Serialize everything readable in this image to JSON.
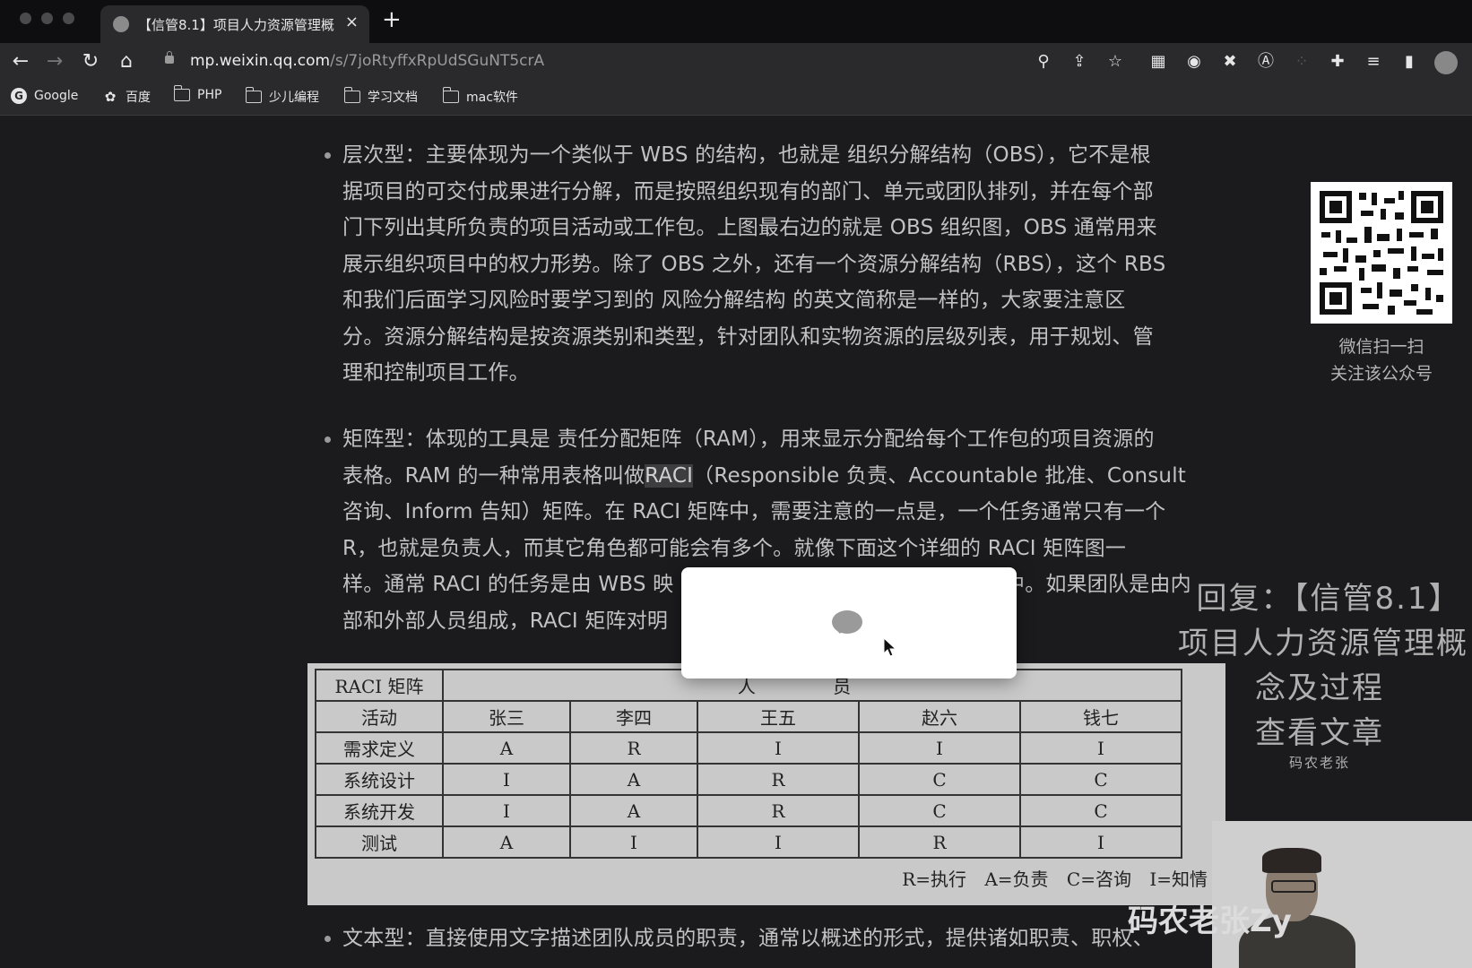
{
  "browser": {
    "tab_title": "【信管8.1】项目人力资源管理概",
    "new_tab": "+",
    "close": "×",
    "url_host": "mp.weixin.qq.com",
    "url_path": "/s/7joRtyffxRpUdSGuNT5crA",
    "bookmarks": [
      "Google",
      "百度",
      "PHP",
      "少儿编程",
      "学习文档",
      "mac软件"
    ]
  },
  "article": {
    "para1_lines": [
      "层次型：主要体现为一个类似于 WBS 的结构，也就是 组织分解结构（OBS），它不是根",
      "据项目的可交付成果进行分解，而是按照组织现有的部门、单元或团队排列，并在每个部",
      "门下列出其所负责的项目活动或工作包。上图最右边的就是 OBS 组织图，OBS 通常用来",
      "展示组织项目中的权力形势。除了 OBS 之外，还有一个资源分解结构（RBS），这个 RBS",
      "和我们后面学习风险时要学习到的 风险分解结构 的英文简称是一样的，大家要注意区",
      "分。资源分解结构是按资源类别和类型，针对团队和实物资源的层级列表，用于规划、管",
      "理和控制项目工作。"
    ],
    "para2_line1": "矩阵型：体现的工具是 责任分配矩阵（RAM），用来显示分配给每个工作包的项目资源的",
    "para2_line2_a": "表格。RAM 的一种常用表格叫做",
    "para2_line2_hl": "RACI",
    "para2_line2_b": "（Responsible 负责、Accountable 批准、Consult",
    "para2_rest": [
      "咨询、Inform 告知）矩阵。在 RACI 矩阵中，需要注意的一点是，一个任务通常只有一个",
      "R，也就是负责人，而其它角色都可能会有多个。就像下面这个详细的 RACI 矩阵图一",
      "样。通常 RACI 的任务是由 WBS 映",
      "部和外部人员组成，RACI 矩阵对明"
    ],
    "para2_line5_tail": "中。如果团队是由内",
    "para3": "文本型：直接使用文字描述团队成员的职责，通常以概述的形式，提供诸如职责、职权、"
  },
  "raci": {
    "corner": "RACI 矩阵",
    "people_header": "人  员",
    "activity_header": "活动",
    "people": [
      "张三",
      "李四",
      "王五",
      "赵六",
      "钱七"
    ],
    "rows": [
      {
        "activity": "需求定义",
        "cells": [
          "A",
          "R",
          "I",
          "I",
          "I"
        ]
      },
      {
        "activity": "系统设计",
        "cells": [
          "I",
          "A",
          "R",
          "C",
          "C"
        ]
      },
      {
        "activity": "系统开发",
        "cells": [
          "I",
          "A",
          "R",
          "C",
          "C"
        ]
      },
      {
        "activity": "测试",
        "cells": [
          "A",
          "I",
          "I",
          "R",
          "I"
        ]
      }
    ],
    "legend": "R=执行 A=负责 C=咨询 I=知情"
  },
  "qr": {
    "caption1": "微信扫一扫",
    "caption2": "关注该公众号"
  },
  "overlay": {
    "line1": "回复：【信管8.1】",
    "line2": "项目人力资源管理概",
    "line3": "念及过程",
    "line4": "查看文章",
    "line5": "码农老张",
    "watermark": "码农老张Zy"
  }
}
